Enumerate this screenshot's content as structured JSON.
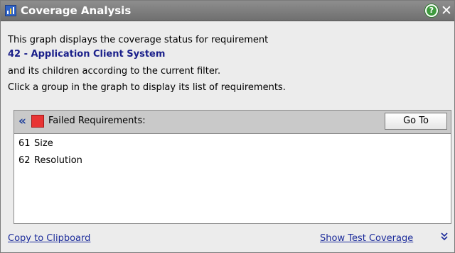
{
  "window": {
    "title": "Coverage Analysis",
    "icons": {
      "title_icon": "bar-chart-icon",
      "help_icon": "help-icon",
      "close_icon": "close-icon"
    },
    "help_glyph": "?",
    "close_glyph": "✕"
  },
  "description": {
    "line1": "This graph displays the coverage status for requirement",
    "requirement": "42 - Application Client System",
    "line3": "and its children according to the current filter.",
    "line4": "Click a group in the graph to display its list of requirements."
  },
  "group_list": {
    "collapse_glyph": "«",
    "status_color": "#e83434",
    "title": "Failed Requirements:",
    "goto_label": "Go To",
    "rows": [
      {
        "id": "61",
        "name": "Size"
      },
      {
        "id": "62",
        "name": "Resolution"
      }
    ]
  },
  "footer": {
    "copy_label": "Copy to Clipboard",
    "show_coverage_label": "Show Test Coverage",
    "expand_glyph": "¥",
    "expand_icon": "double-chevron-down-icon"
  },
  "colors": {
    "titlebar": "#7f7f7f",
    "link": "#1a2a9a",
    "requirement_text": "#1a1f8a"
  }
}
